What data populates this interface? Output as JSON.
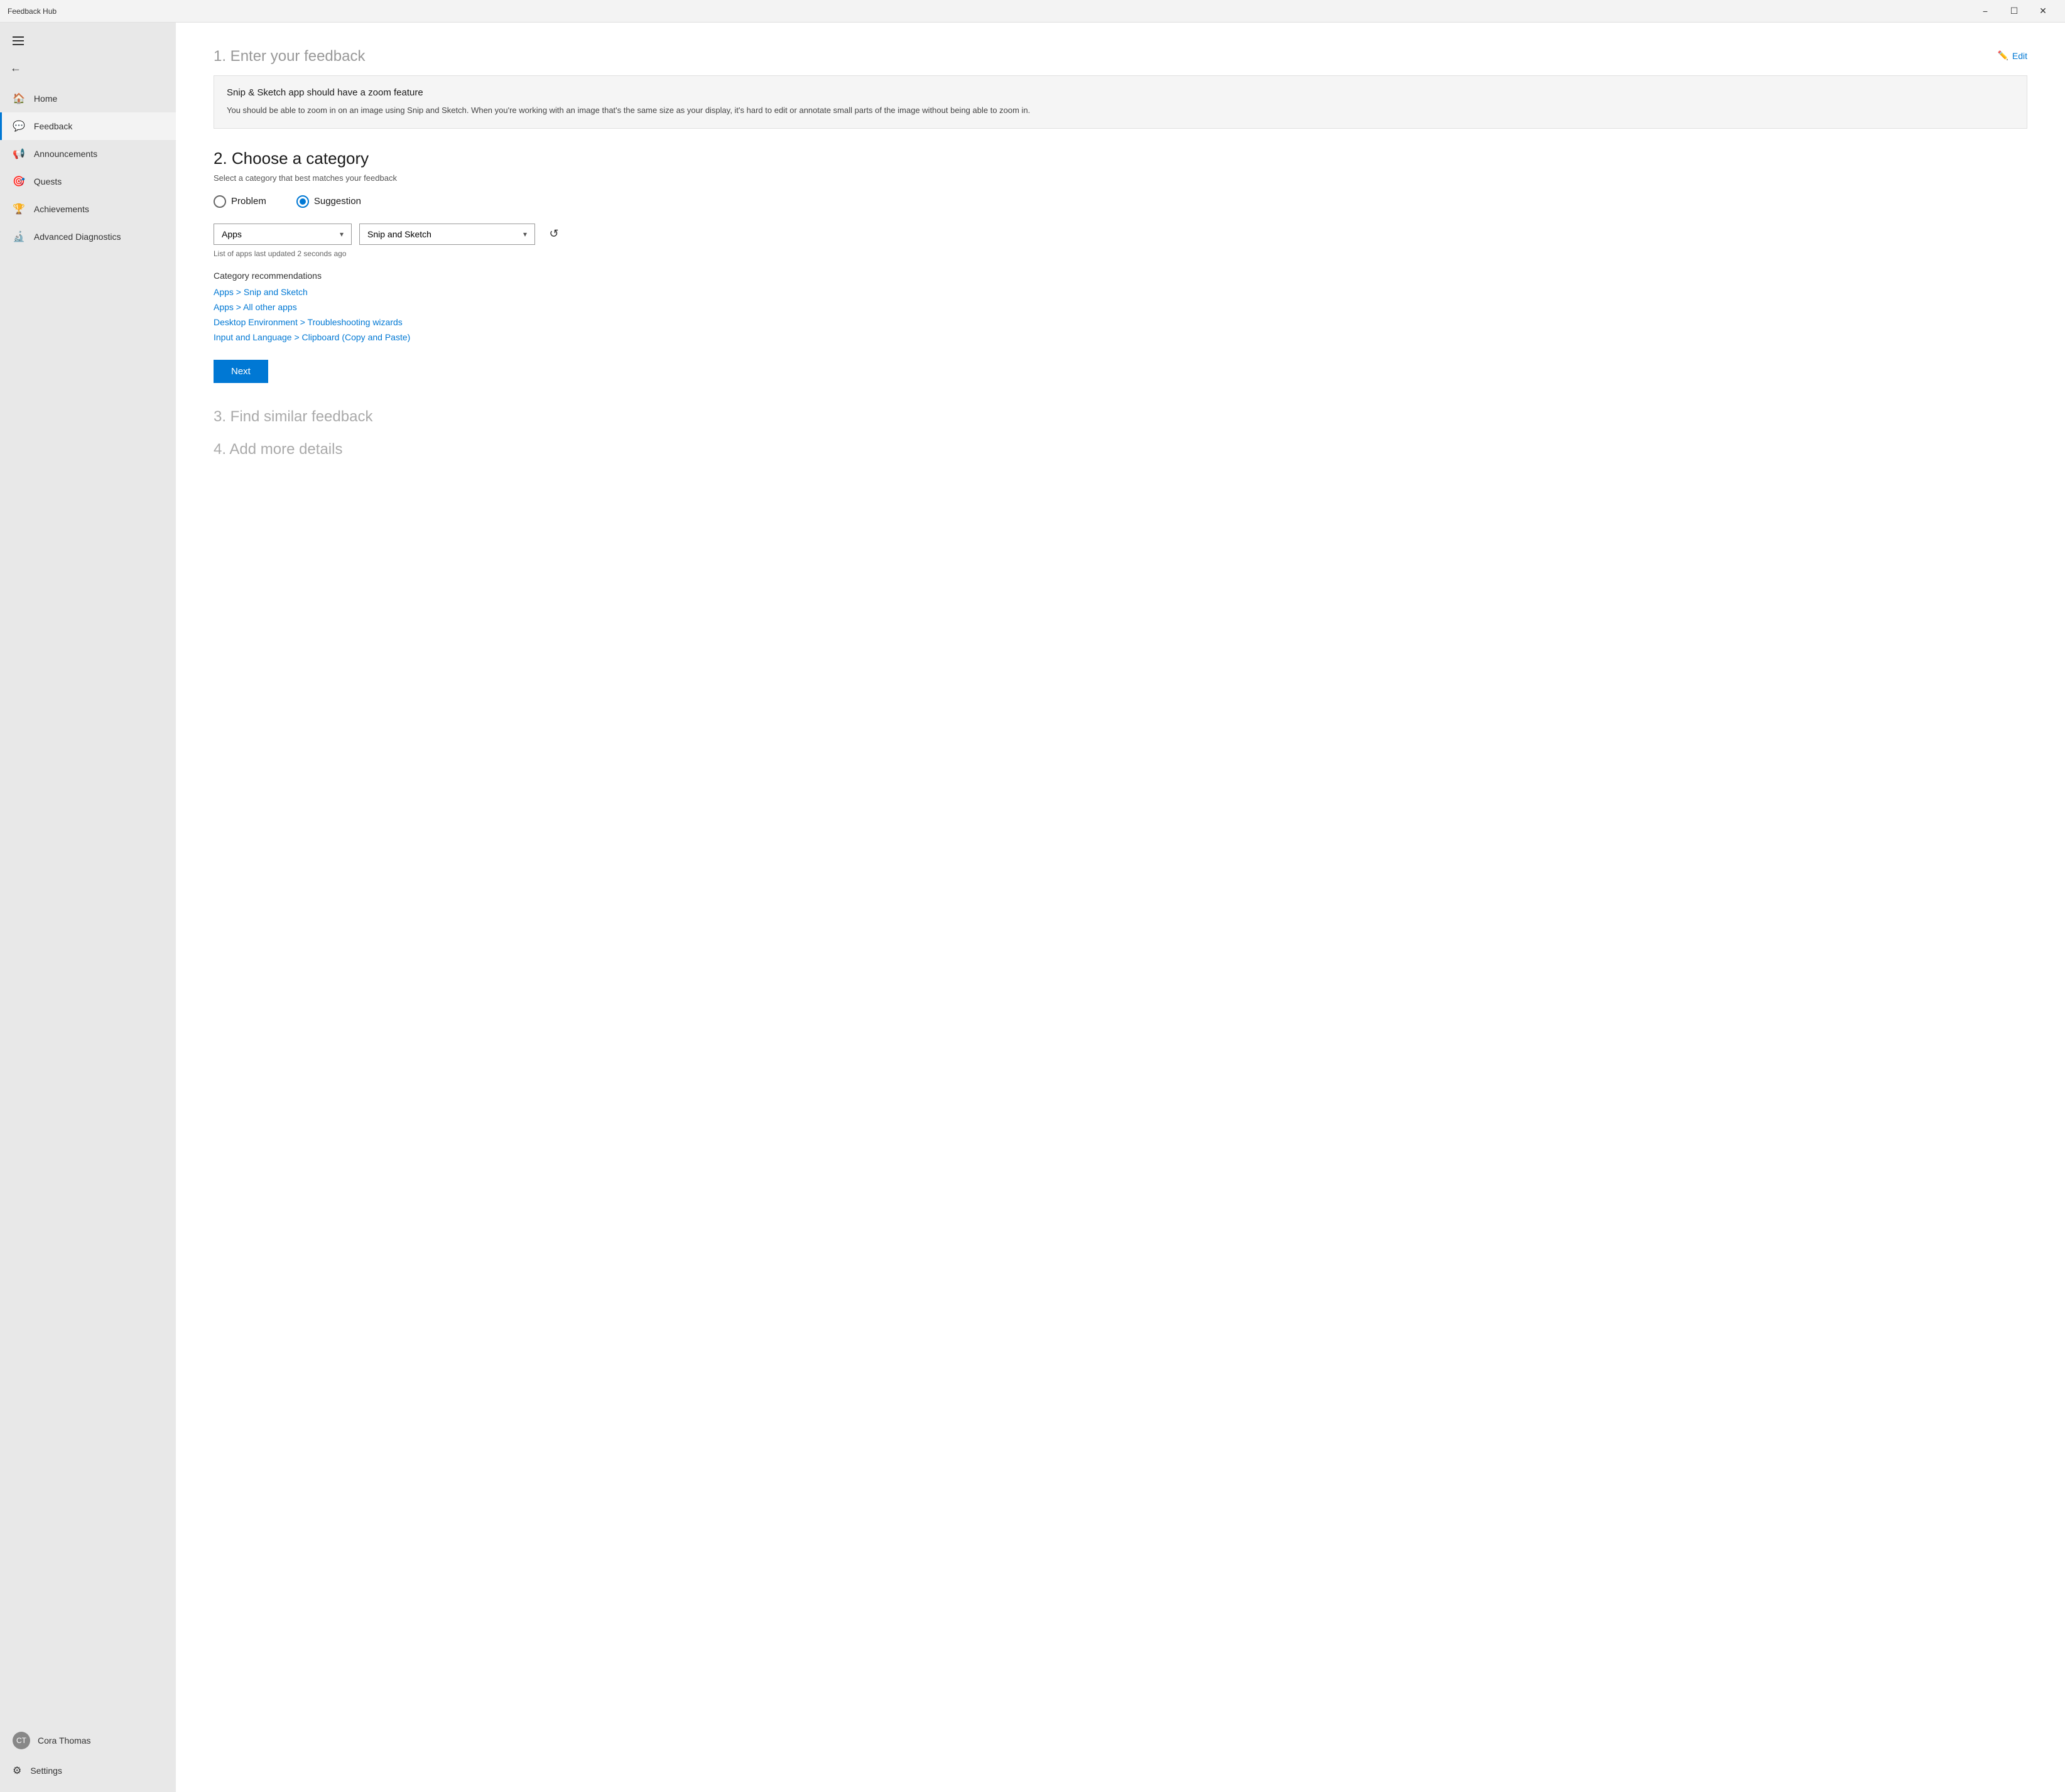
{
  "titleBar": {
    "title": "Feedback Hub",
    "minimizeLabel": "−",
    "maximizeLabel": "☐",
    "closeLabel": "✕"
  },
  "sidebar": {
    "hamburger": "☰",
    "backArrow": "←",
    "navItems": [
      {
        "id": "home",
        "label": "Home",
        "icon": "🏠",
        "active": false
      },
      {
        "id": "feedback",
        "label": "Feedback",
        "icon": "💬",
        "active": true
      },
      {
        "id": "announcements",
        "label": "Announcements",
        "icon": "📢",
        "active": false
      },
      {
        "id": "quests",
        "label": "Quests",
        "icon": "🎯",
        "active": false
      },
      {
        "id": "achievements",
        "label": "Achievements",
        "icon": "🏆",
        "active": false
      },
      {
        "id": "advanced-diagnostics",
        "label": "Advanced Diagnostics",
        "icon": "🔬",
        "active": false
      }
    ],
    "user": {
      "name": "Cora Thomas",
      "initials": "CT"
    },
    "settingsLabel": "Settings",
    "settingsIcon": "⚙"
  },
  "main": {
    "section1": {
      "title": "1. Enter your feedback",
      "editLabel": "Edit",
      "feedbackTitle": "Snip & Sketch app should have a zoom feature",
      "feedbackBody": "You should be able to zoom in on an image using Snip and Sketch. When you're working with an image that's the same size as your display, it's hard to edit or annotate small parts of the image without being able to zoom in."
    },
    "section2": {
      "title": "2. Choose a category",
      "subtitle": "Select a category that best matches your feedback",
      "problemLabel": "Problem",
      "suggestionLabel": "Suggestion",
      "selectedOption": "suggestion",
      "category1": {
        "selected": "Apps",
        "placeholder": "Apps"
      },
      "category2": {
        "selected": "Snip and Sketch",
        "placeholder": "Snip and Sketch"
      },
      "lastUpdated": "List of apps last updated 2 seconds ago",
      "categoryRecsTitle": "Category recommendations",
      "recommendations": [
        {
          "id": "rec1",
          "label": "Apps > Snip and Sketch"
        },
        {
          "id": "rec2",
          "label": "Apps > All other apps"
        },
        {
          "id": "rec3",
          "label": "Desktop Environment > Troubleshooting wizards"
        },
        {
          "id": "rec4",
          "label": "Input and Language > Clipboard (Copy and Paste)"
        }
      ],
      "nextButton": "Next"
    },
    "section3": {
      "title": "3. Find similar feedback"
    },
    "section4": {
      "title": "4. Add more details"
    }
  }
}
